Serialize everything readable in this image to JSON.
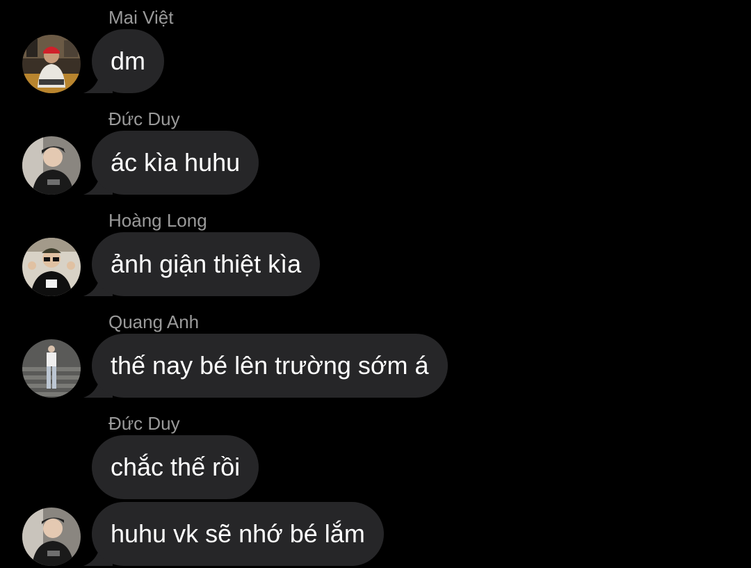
{
  "colors": {
    "background": "#000000",
    "bubble": "#262628",
    "message_text": "#ffffff",
    "sender_name": "#9a9a9a"
  },
  "messages": [
    {
      "sender": "Mai Việt",
      "text": "dm",
      "avatar_icon": "user-photo-icon"
    },
    {
      "sender": "Đức Duy",
      "text": "ác kìa huhu",
      "avatar_icon": "user-photo-icon"
    },
    {
      "sender": "Hoàng Long",
      "text": "ảnh giận thiệt kìa",
      "avatar_icon": "user-photo-icon"
    },
    {
      "sender": "Quang Anh",
      "text": "thế nay bé lên trường sớm á",
      "avatar_icon": "user-photo-icon"
    },
    {
      "sender": "Đức Duy",
      "text": "chắc thế rồi",
      "avatar_icon": null
    },
    {
      "sender": null,
      "text": "huhu vk sẽ nhớ bé lắm",
      "avatar_icon": "user-photo-icon"
    }
  ]
}
